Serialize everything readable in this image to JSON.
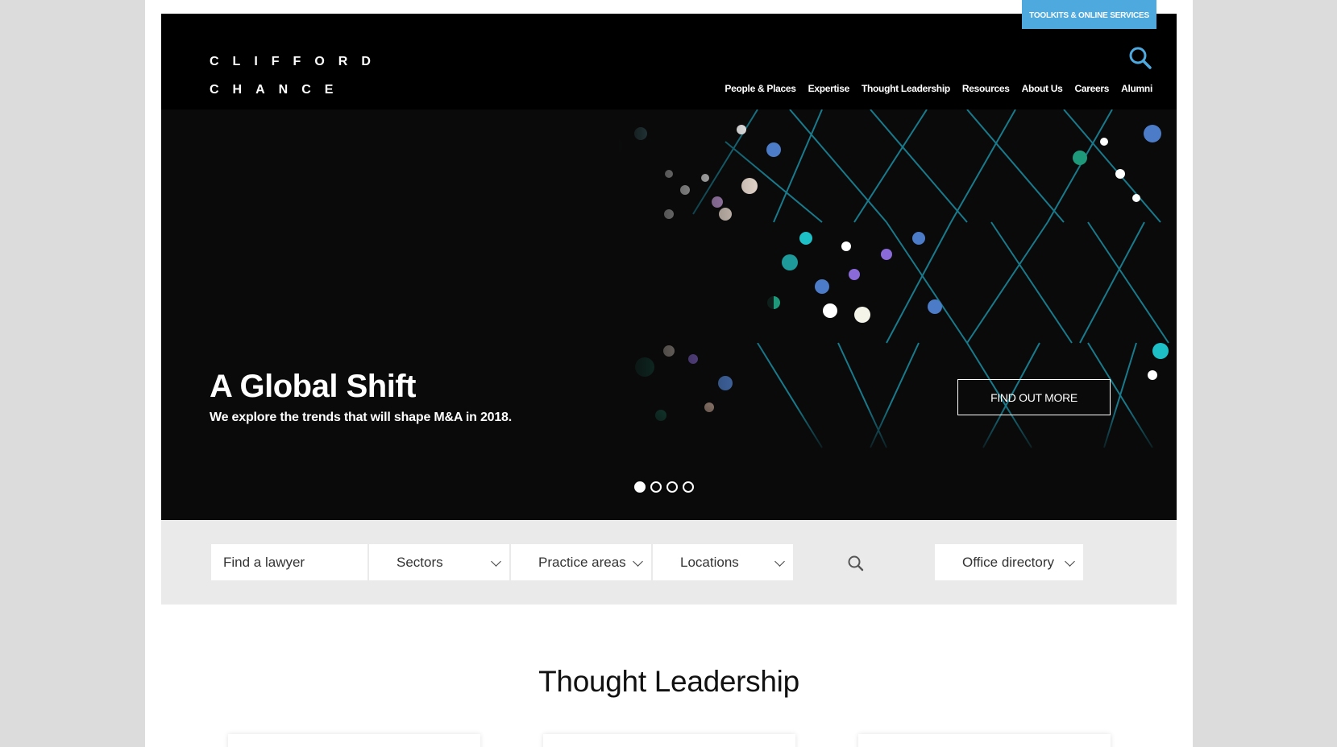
{
  "header": {
    "toolkits_label": "TOOLKITS & ONLINE SERVICES",
    "logo_line1": "CLIFFORD",
    "logo_line2": "CHANCE",
    "nav": [
      "People & Places",
      "Expertise",
      "Thought Leadership",
      "Resources",
      "About Us",
      "Careers",
      "Alumni"
    ]
  },
  "hero": {
    "title": "A Global Shift",
    "subtitle": "We explore the trends that will shape M&A in 2018.",
    "cta_label": "FIND OUT MORE",
    "slide_count": 4,
    "active_slide": 1
  },
  "filters": {
    "find_lawyer": "Find a lawyer",
    "sectors": "Sectors",
    "practice_areas": "Practice areas",
    "locations": "Locations",
    "office_directory": "Office directory"
  },
  "thought_leadership": {
    "title": "Thought Leadership"
  },
  "colors": {
    "accent": "#4ea9de",
    "header_bg": "#000000",
    "filter_bg": "#eaeaea",
    "page_bg": "#dcdcdc"
  },
  "icons": [
    "search-icon",
    "chevron-down-icon"
  ]
}
